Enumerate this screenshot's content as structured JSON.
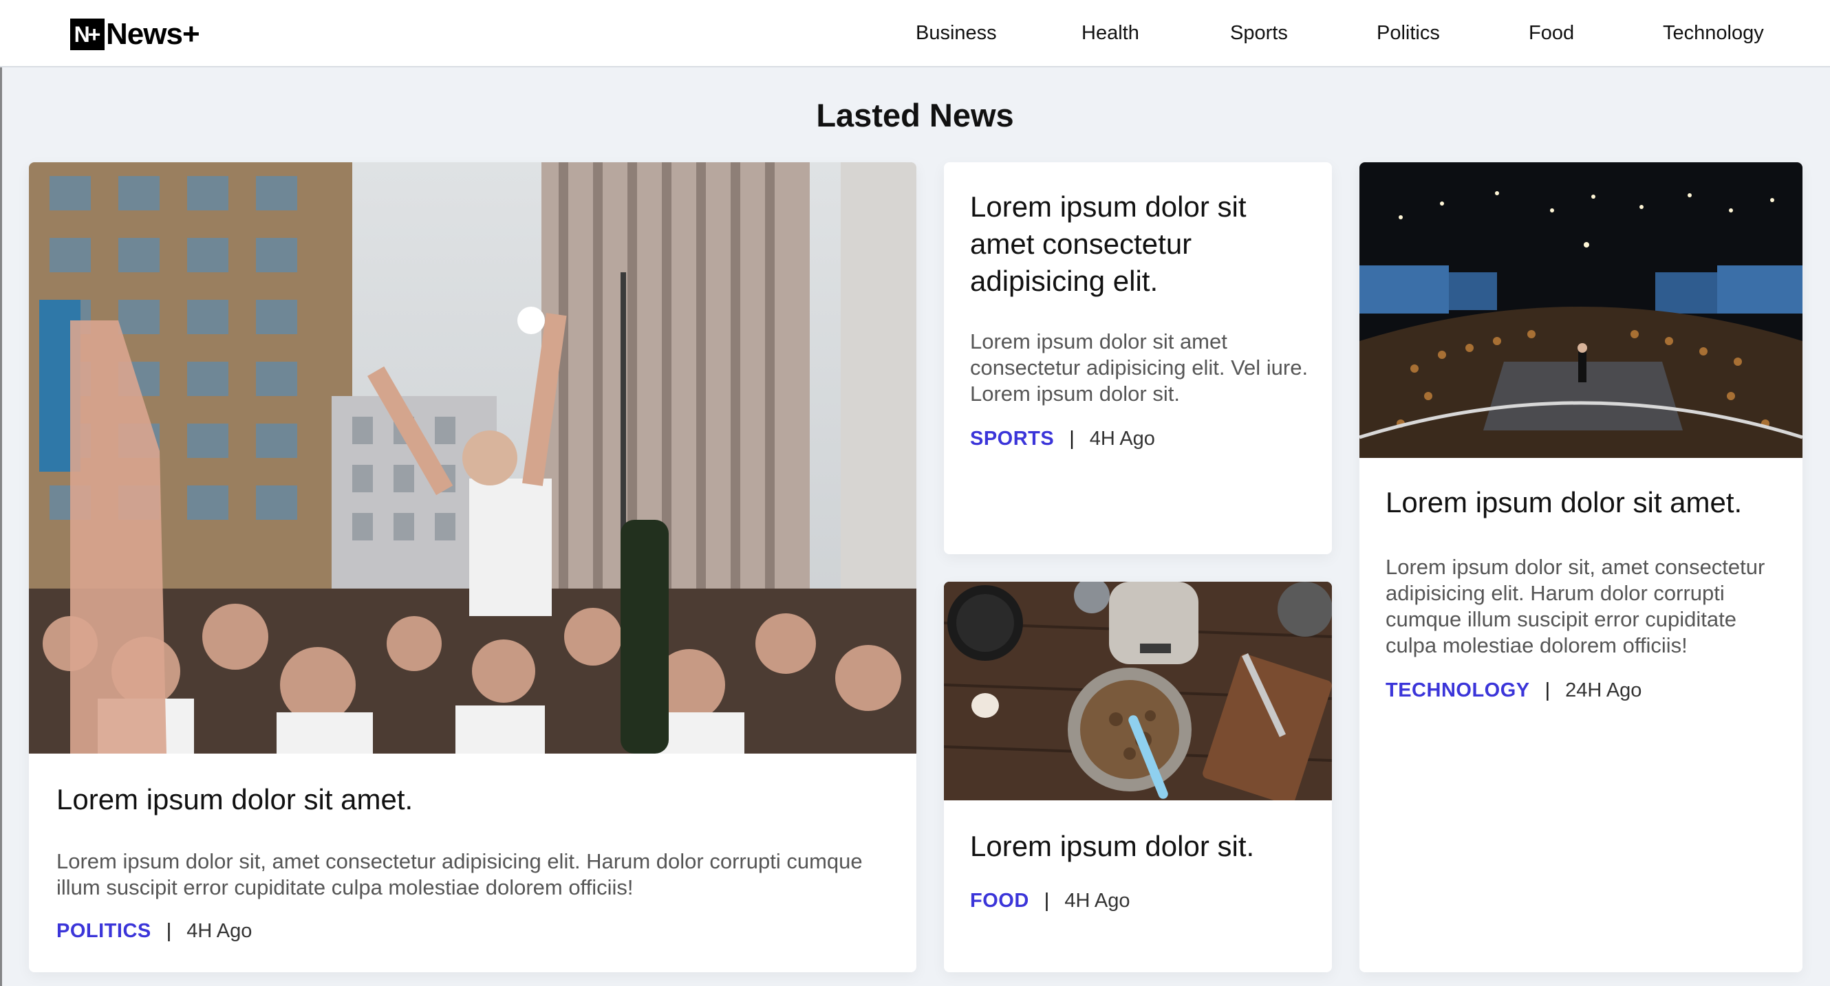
{
  "brand": {
    "logo_mark": "N+",
    "name": "News+"
  },
  "nav": {
    "items": [
      "Business",
      "Health",
      "Sports",
      "Politics",
      "Food",
      "Technology"
    ]
  },
  "page": {
    "title": "Lasted News"
  },
  "articles": [
    {
      "title": "Lorem ipsum dolor sit amet.",
      "excerpt": "Lorem ipsum dolor sit, amet consectetur adipisicing elit. Harum dolor corrupti cumque illum suscipit error cupiditate culpa molestiae dolorem officiis!",
      "category": "POLITICS",
      "time": "4H Ago",
      "image": "crowd-celebration-photo"
    },
    {
      "title": "Lorem ipsum dolor sit amet consectetur adipisicing elit.",
      "excerpt": "Lorem ipsum dolor sit amet consectetur adipisicing elit. Vel iure. Lorem ipsum dolor sit.",
      "category": "SPORTS",
      "time": "4H Ago"
    },
    {
      "title": "Lorem ipsum dolor sit.",
      "category": "FOOD",
      "time": "4H Ago",
      "image": "cooking-table-photo"
    },
    {
      "title": "Lorem ipsum dolor sit amet.",
      "excerpt": "Lorem ipsum dolor sit, amet consectetur adipisicing elit. Harum dolor corrupti cumque illum suscipit error cupiditate culpa molestiae dolorem officiis!",
      "category": "TECHNOLOGY",
      "time": "24H Ago",
      "image": "conference-hall-photo"
    }
  ],
  "colors": {
    "accent": "#3b35d9",
    "background": "#eff2f6",
    "card": "#ffffff"
  }
}
